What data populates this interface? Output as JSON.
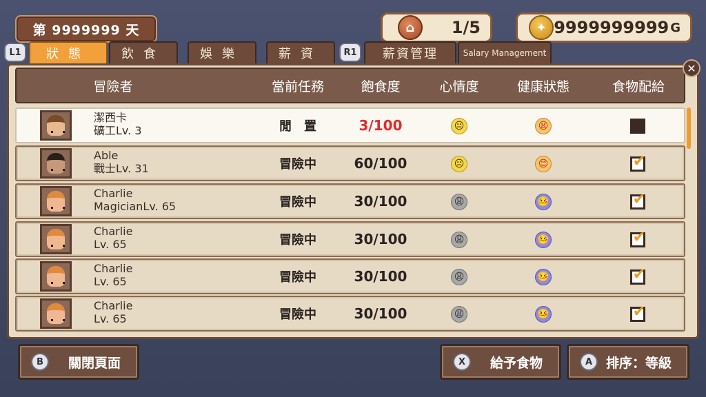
{
  "day": {
    "label": "第 9999999 天"
  },
  "resources": {
    "rooms": "1/5",
    "gold": "9999999999",
    "gold_suffix": "G"
  },
  "hints": {
    "l1": "L1",
    "r1": "R1",
    "close": "✕"
  },
  "tabs": [
    {
      "label": "狀態"
    },
    {
      "label": "飲食"
    },
    {
      "label": "娛樂"
    },
    {
      "label": "薪資"
    },
    {
      "label": "薪資管理"
    },
    {
      "label": "Salary Management"
    }
  ],
  "headers": {
    "adventurer": "冒險者",
    "task": "當前任務",
    "satiety": "飽食度",
    "mood": "心情度",
    "health": "健康狀態",
    "food": "食物配給"
  },
  "rows": [
    {
      "name": "潔西卡",
      "class": "礦工Lv. 3",
      "task": "閒　置",
      "food": "3/100",
      "mood": "😐",
      "health": "😫",
      "ration": ""
    },
    {
      "name": "Able",
      "class": "戰士Lv. 31",
      "task": "冒險中",
      "food": "60/100",
      "mood": "😐",
      "health": "😊",
      "ration": "✔"
    },
    {
      "name": "Charlie",
      "class": "MagicianLv. 65",
      "task": "冒險中",
      "food": "30/100",
      "mood": "😩",
      "health": "🤒",
      "ration": "✔"
    },
    {
      "name": "Charlie",
      "class": "Lv. 65",
      "task": "冒險中",
      "food": "30/100",
      "mood": "😩",
      "health": "🤒",
      "ration": "✔"
    },
    {
      "name": "Charlie",
      "class": "Lv. 65",
      "task": "冒險中",
      "food": "30/100",
      "mood": "😩",
      "health": "🤒",
      "ration": "✔"
    },
    {
      "name": "Charlie",
      "class": "Lv. 65",
      "task": "冒險中",
      "food": "30/100",
      "mood": "😩",
      "health": "🤒",
      "ration": "✔"
    }
  ],
  "buttons": {
    "close": {
      "icon": "B",
      "label": "關閉頁面"
    },
    "give_food": {
      "icon": "X",
      "label": "給予食物"
    },
    "sort": {
      "icon": "A",
      "label": "排序：等級"
    }
  }
}
